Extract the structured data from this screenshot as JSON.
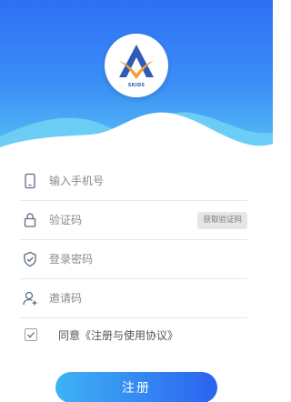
{
  "logo": {
    "text": "SKIDS"
  },
  "form": {
    "phone": {
      "placeholder": "输入手机号",
      "icon": "phone-icon"
    },
    "code": {
      "placeholder": "验证码",
      "icon": "lock-icon",
      "button_label": "获取验证码"
    },
    "password": {
      "placeholder": "登录密码",
      "icon": "shield-icon"
    },
    "invite": {
      "placeholder": "邀请码",
      "icon": "user-add-icon"
    }
  },
  "agreement": {
    "checked": true,
    "label": "同意《注册与使用协议》"
  },
  "register_label": "注册",
  "colors": {
    "header_top": "#2f6ff5",
    "header_bottom": "#59c2f3",
    "button_start": "#3eb3f5",
    "button_end": "#2b62ef",
    "icon_color": "#5b6b86"
  }
}
